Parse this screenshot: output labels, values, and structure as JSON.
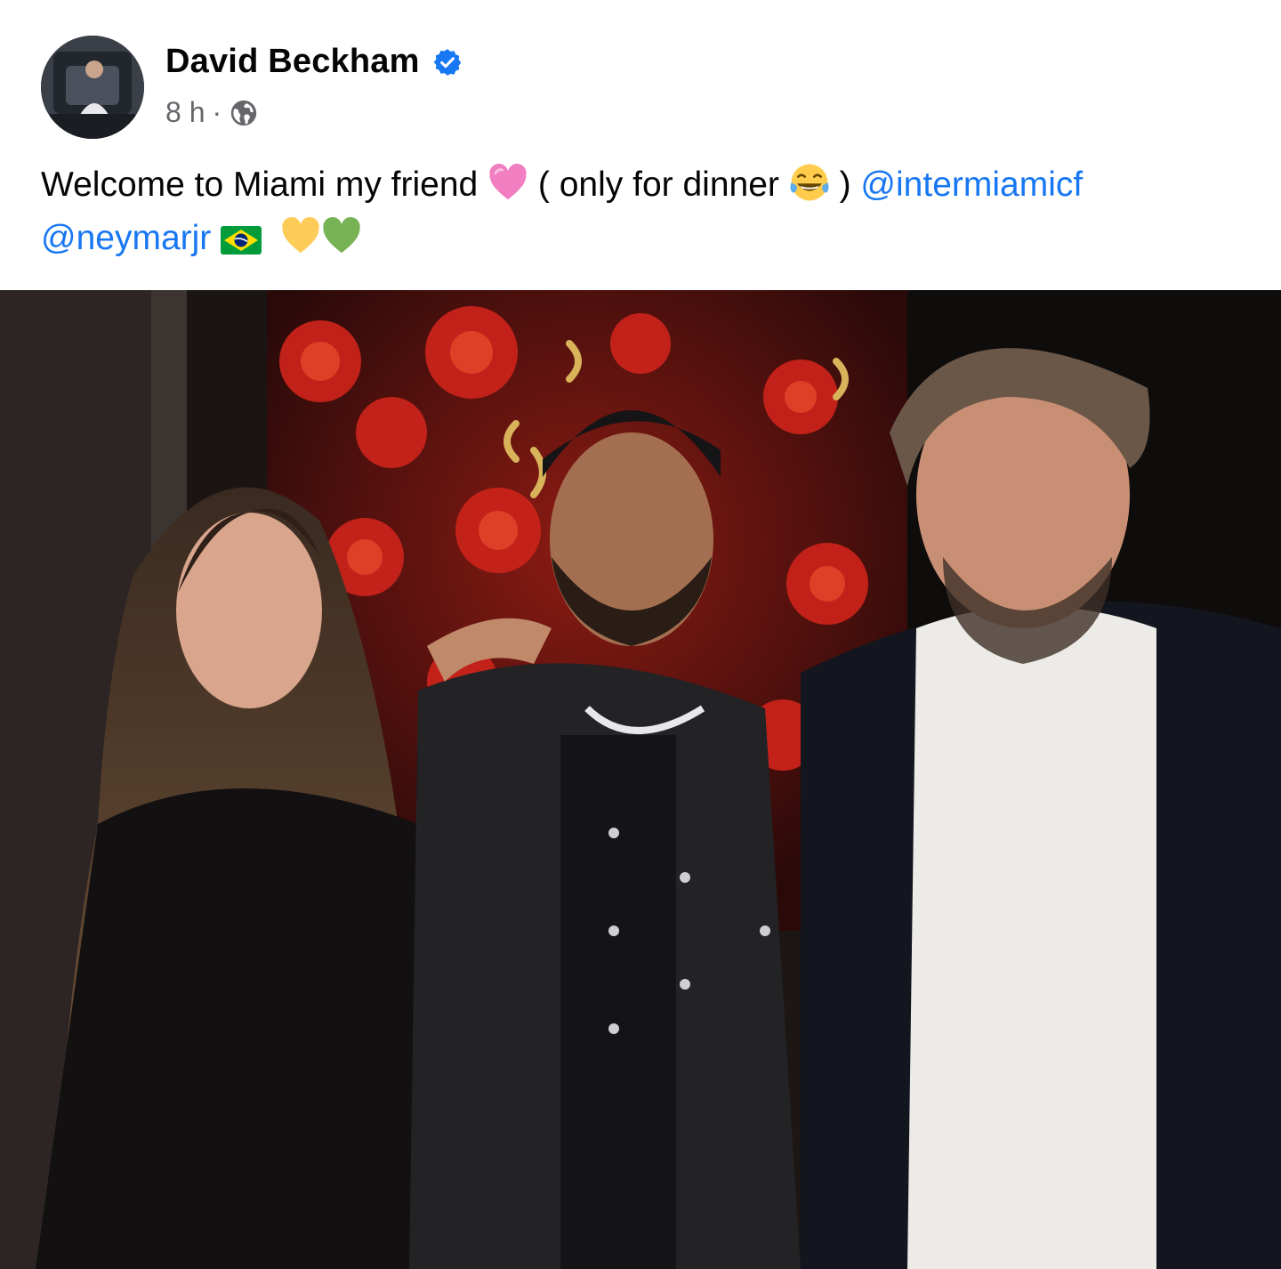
{
  "post": {
    "author": "David Beckham",
    "verified": true,
    "timestamp": "8 h",
    "separator": "·",
    "audience_icon": "globe-icon",
    "caption": {
      "text_1": "Welcome to Miami my friend",
      "emoji_1": "pink-heart",
      "text_2": "( only for dinner",
      "emoji_2": "face-with-tears-of-joy",
      "text_3": ")",
      "mention_1": "@intermiamicf",
      "mention_2": "@neymarjr",
      "flag": "brazil-flag",
      "emoji_3": "yellow-heart",
      "emoji_4": "green-heart"
    },
    "photo_icon": "post-photo"
  },
  "colors": {
    "link": "#1877f2",
    "verified_badge": "#1877f2",
    "meta_text": "#65676b",
    "text": "#050505"
  }
}
